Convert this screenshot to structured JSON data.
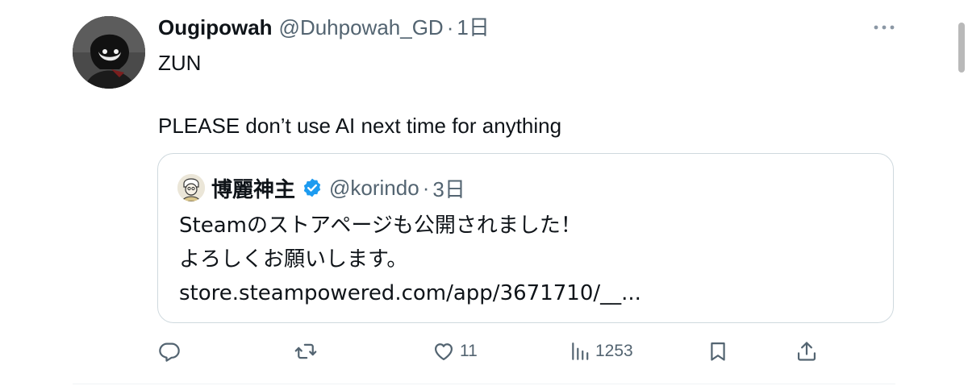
{
  "tweet": {
    "display_name": "Ougipowah",
    "handle": "@Duhpowah_GD",
    "separator": "·",
    "time": "1日",
    "text_line1": "ZUN",
    "text_line2": "PLEASE don’t use AI next time for anything"
  },
  "quote": {
    "display_name": "博麗神主",
    "verified": true,
    "handle": "@korindo",
    "separator": "·",
    "time": "3日",
    "lines": [
      "Steamのストアページも公開されました！",
      "よろしくお願いします。",
      "store.steampowered.com/app/3671710/__..."
    ]
  },
  "actions": {
    "reply": {
      "icon": "reply-icon",
      "count": ""
    },
    "retweet": {
      "icon": "retweet-icon",
      "count": ""
    },
    "like": {
      "icon": "heart-icon",
      "count": "11"
    },
    "views": {
      "icon": "views-icon",
      "count": "1253"
    },
    "bookmark": {
      "icon": "bookmark-icon"
    },
    "share": {
      "icon": "share-icon"
    }
  },
  "colors": {
    "text_primary": "#0f1419",
    "text_secondary": "#536471",
    "border": "#cfd9de",
    "verified": "#1d9bf0"
  }
}
